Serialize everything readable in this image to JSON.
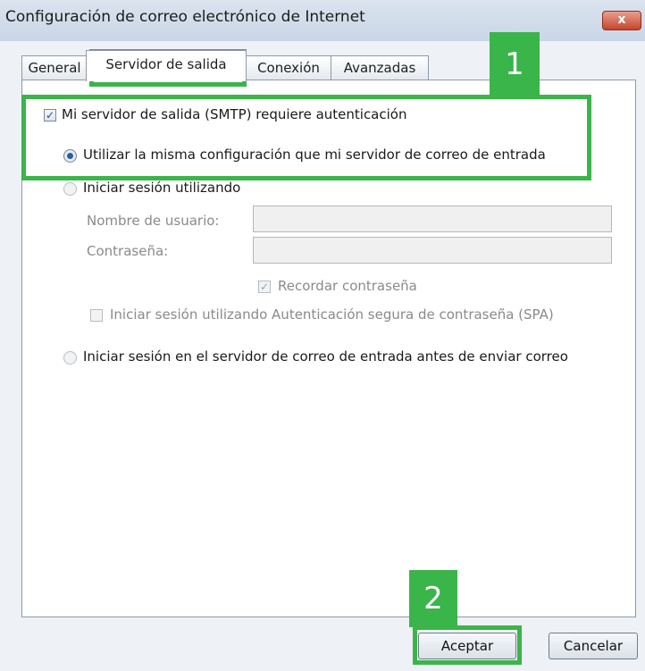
{
  "window": {
    "title": "Configuración de correo electrónico de Internet",
    "close_label": "x"
  },
  "tabs": [
    "General",
    "Servidor de salida",
    "Conexión",
    "Avanzadas"
  ],
  "smtp_auth": {
    "label": "Mi servidor de salida (SMTP) requiere autenticación",
    "checked": true
  },
  "options": {
    "same_settings": "Utilizar la misma configuración que mi servidor de correo de entrada",
    "login_using": "Iniciar sesión utilizando",
    "login_incoming_first": "Iniciar sesión en el servidor de correo de entrada antes de enviar correo"
  },
  "fields": {
    "username_label": "Nombre de usuario:",
    "username_value": "",
    "password_label": "Contraseña:",
    "password_value": ""
  },
  "remember_password": {
    "label": "Recordar contraseña",
    "checked": true
  },
  "spa": {
    "label": "Iniciar sesión utilizando Autenticación segura de contraseña (SPA)",
    "checked": false
  },
  "buttons": {
    "ok": "Aceptar",
    "cancel": "Cancelar"
  },
  "annotations": {
    "step1": "1",
    "step2": "2"
  },
  "colors": {
    "highlight": "#3bb54a",
    "radio_selected": "#2a5da8"
  },
  "glyphs": {
    "check": "✓"
  }
}
